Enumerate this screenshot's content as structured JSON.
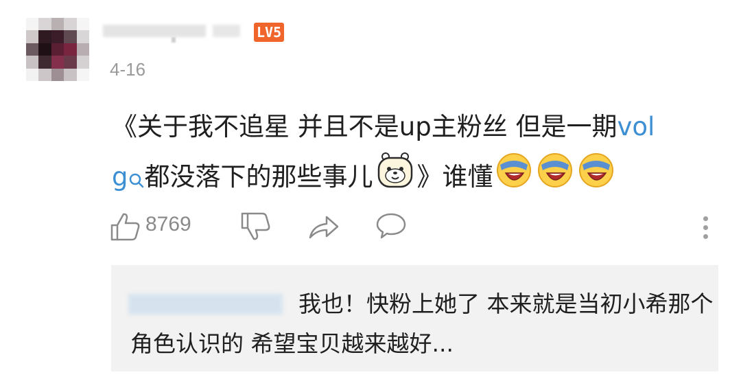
{
  "comment": {
    "author": {
      "level_badge": "LV5"
    },
    "date": "4-16",
    "text_part1": "《关于我不追星 并且不是up主粉丝 但是一期",
    "text_link": "vol",
    "text_link2": "g",
    "text_part2": "都没落下的那些事儿",
    "text_part3": "》谁懂",
    "like_count": "8769"
  },
  "reply": {
    "text": "我也！快粉上她了 本来就是当初小希那个角色认识的 希望宝贝越来越好..."
  },
  "colors": {
    "level_badge": "#f0652c",
    "link": "#3d8fd4",
    "meta_gray": "#9a9a9a",
    "reply_bg": "#f2f2f2"
  },
  "icons": [
    "like-icon",
    "dislike-icon",
    "share-icon",
    "reply-icon",
    "more-vertical-icon",
    "search-icon",
    "bear-emoji-icon",
    "laugh-cry-emoji-icon"
  ]
}
